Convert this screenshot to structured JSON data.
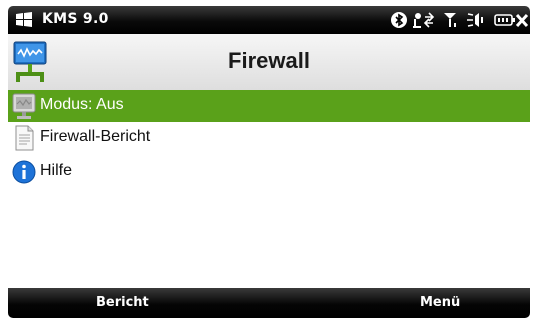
{
  "statusbar": {
    "app_title": "KMS 9.0",
    "icons": [
      "bluetooth-icon",
      "connectivity-icon",
      "signal-icon",
      "volume-icon",
      "battery-icon",
      "close-icon"
    ]
  },
  "header": {
    "title": "Firewall",
    "icon": "firewall-network-icon"
  },
  "list": {
    "items": [
      {
        "label": "Modus: Aus",
        "icon": "monitor-icon",
        "selected": true
      },
      {
        "label": "Firewall-Bericht",
        "icon": "document-icon",
        "selected": false
      },
      {
        "label": "Hilfe",
        "icon": "info-icon",
        "selected": false
      }
    ]
  },
  "softkeys": {
    "left": "Bericht",
    "right": "Menü"
  },
  "colors": {
    "selection": "#5aa11a",
    "bar": "#000000",
    "header_bg": "#e8e8e8"
  }
}
